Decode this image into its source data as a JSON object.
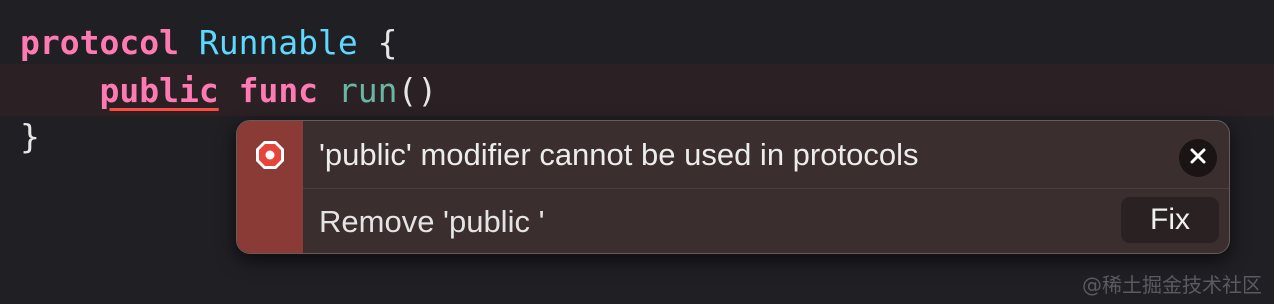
{
  "editor": {
    "lines": [
      {
        "tokens": [
          {
            "text": "protocol",
            "kind": "keyword"
          },
          {
            "text": " ",
            "kind": "plain"
          },
          {
            "text": "Runnable",
            "kind": "type"
          },
          {
            "text": " {",
            "kind": "plain"
          }
        ]
      },
      {
        "tokens": [
          {
            "text": "    ",
            "kind": "plain"
          },
          {
            "text": "public",
            "kind": "keyword"
          },
          {
            "text": " ",
            "kind": "plain"
          },
          {
            "text": "func",
            "kind": "keyword"
          },
          {
            "text": " ",
            "kind": "plain"
          },
          {
            "text": "run",
            "kind": "function"
          },
          {
            "text": "()",
            "kind": "plain"
          }
        ]
      },
      {
        "tokens": [
          {
            "text": "}",
            "kind": "plain"
          }
        ]
      }
    ]
  },
  "diagnostic": {
    "severity_icon": "error-octagon-icon",
    "message": "'public' modifier cannot be used in protocols",
    "fix_description": "Remove 'public '",
    "fix_label": "Fix",
    "close_icon": "close-icon"
  },
  "watermark": "@稀土掘金技术社区",
  "colors": {
    "background": "#1f1f24",
    "keyword": "#ff7ab2",
    "type": "#5dd8ff",
    "function": "#67b7a4",
    "error_stripe": "#8a3b35",
    "error_red": "#e5453a"
  }
}
